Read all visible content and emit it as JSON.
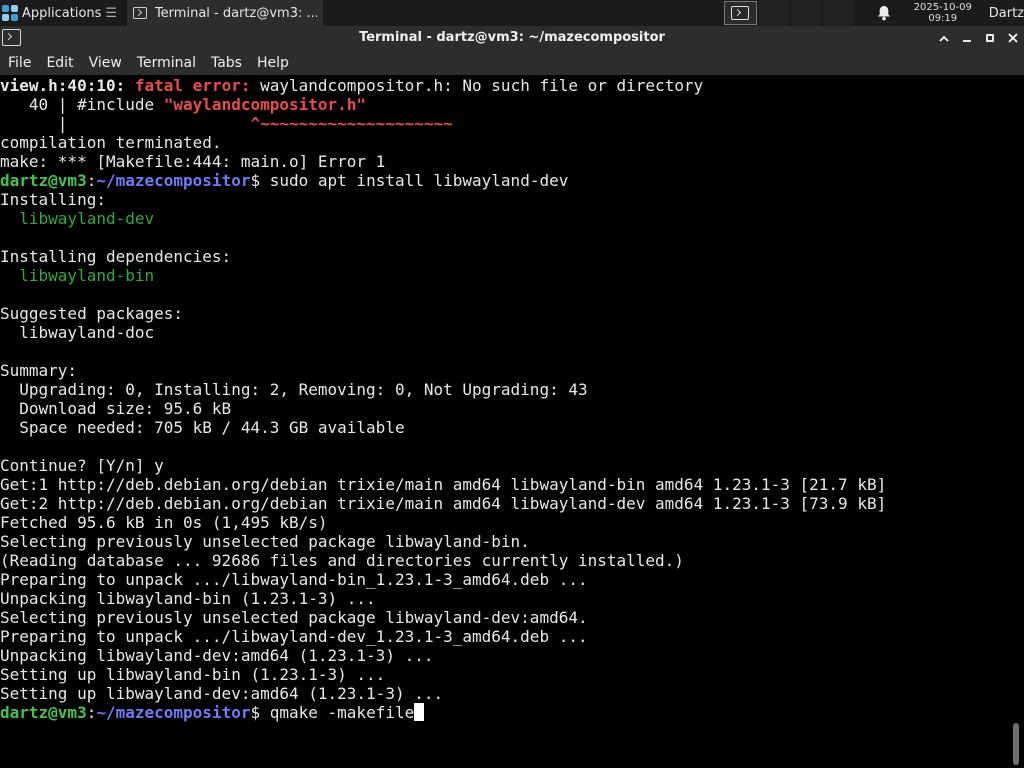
{
  "panel": {
    "applications_label": "Applications",
    "task_label": "Terminal - dartz@vm3: ...",
    "clock_date": "2025-10-09",
    "clock_time": "09:19",
    "user": "Dartz",
    "icons": [
      "applications-icon",
      "terminal-icon",
      "workspace-icon",
      "notification-bell-icon"
    ]
  },
  "window": {
    "title": "Terminal - dartz@vm3: ~/mazecompositor",
    "controls": [
      "maximize-up",
      "minimize",
      "restore",
      "close"
    ]
  },
  "menu": [
    "File",
    "Edit",
    "View",
    "Terminal",
    "Tabs",
    "Help"
  ],
  "prompt": {
    "user_host": "dartz@vm3",
    "path": "~/mazecompositor"
  },
  "terminal": {
    "err_file": "view.h:40:10:",
    "err_label": "fatal error:",
    "err_msg": "waylandcompositor.h: No such file or directory",
    "inc_prefix": "   40 | #include ",
    "inc_file": "\"waylandcompositor.h\"",
    "caret_prefix": "      |                   ",
    "caret_marks": "^~~~~~~~~~~~~~~~~~~~~",
    "compilation": "compilation terminated.",
    "make_error": "make: *** [Makefile:444: main.o] Error 1",
    "cmd1": "$ sudo apt install libwayland-dev",
    "installing": "Installing:",
    "pkg_dev": "  libwayland-dev",
    "installing_deps": "Installing dependencies:",
    "pkg_bin": "  libwayland-bin",
    "suggested": "Suggested packages:",
    "pkg_doc": "  libwayland-doc",
    "summary": "Summary:",
    "sum1": "  Upgrading: 0, Installing: 2, Removing: 0, Not Upgrading: 43",
    "sum2": "  Download size: 95.6 kB",
    "sum3": "  Space needed: 705 kB / 44.3 GB available",
    "continue": "Continue? [Y/n] y",
    "get1": "Get:1 http://deb.debian.org/debian trixie/main amd64 libwayland-bin amd64 1.23.1-3 [21.7 kB]",
    "get2": "Get:2 http://deb.debian.org/debian trixie/main amd64 libwayland-dev amd64 1.23.1-3 [73.9 kB]",
    "fetched": "Fetched 95.6 kB in 0s (1,495 kB/s)",
    "sel1": "Selecting previously unselected package libwayland-bin.",
    "reading": "(Reading database ... 92686 files and directories currently installed.)",
    "prep1": "Preparing to unpack .../libwayland-bin_1.23.1-3_amd64.deb ...",
    "unpack1": "Unpacking libwayland-bin (1.23.1-3) ...",
    "sel2": "Selecting previously unselected package libwayland-dev:amd64.",
    "prep2": "Preparing to unpack .../libwayland-dev_1.23.1-3_amd64.deb ...",
    "unpack2": "Unpacking libwayland-dev:amd64 (1.23.1-3) ...",
    "setup1": "Setting up libwayland-bin (1.23.1-3) ...",
    "setup2": "Setting up libwayland-dev:amd64 (1.23.1-3) ...",
    "cmd2": "$ qmake -makefile"
  }
}
